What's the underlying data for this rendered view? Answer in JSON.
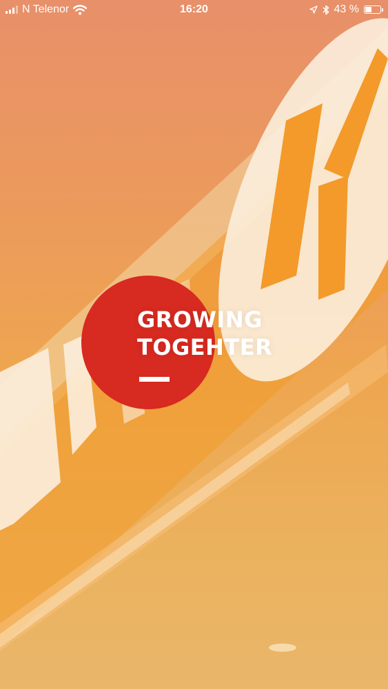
{
  "status_bar": {
    "carrier": "N Telenor",
    "time": "16:20",
    "battery_percent": "43 %",
    "battery_level": 0.43
  },
  "splash": {
    "line1": "GROWING",
    "line2": "TOGEHTER"
  },
  "background": {
    "storefront_letters": "RCLE K"
  },
  "colors": {
    "circle": "#d72a20",
    "text": "#ffffff"
  }
}
